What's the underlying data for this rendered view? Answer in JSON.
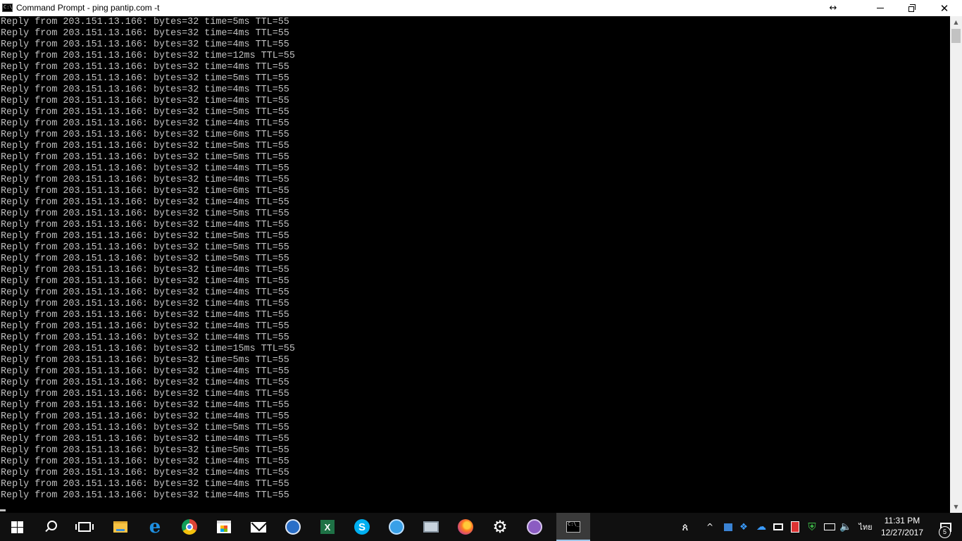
{
  "window": {
    "title": "Command Prompt - ping  pantip.com -t",
    "icon_text": "C:\\",
    "controls": {
      "resize_glyph": "↔",
      "close_glyph": "✕"
    }
  },
  "console": {
    "lines": [
      "Reply from 203.151.13.166: bytes=32 time=5ms TTL=55",
      "Reply from 203.151.13.166: bytes=32 time=4ms TTL=55",
      "Reply from 203.151.13.166: bytes=32 time=4ms TTL=55",
      "Reply from 203.151.13.166: bytes=32 time=12ms TTL=55",
      "Reply from 203.151.13.166: bytes=32 time=4ms TTL=55",
      "Reply from 203.151.13.166: bytes=32 time=5ms TTL=55",
      "Reply from 203.151.13.166: bytes=32 time=4ms TTL=55",
      "Reply from 203.151.13.166: bytes=32 time=4ms TTL=55",
      "Reply from 203.151.13.166: bytes=32 time=5ms TTL=55",
      "Reply from 203.151.13.166: bytes=32 time=4ms TTL=55",
      "Reply from 203.151.13.166: bytes=32 time=6ms TTL=55",
      "Reply from 203.151.13.166: bytes=32 time=5ms TTL=55",
      "Reply from 203.151.13.166: bytes=32 time=5ms TTL=55",
      "Reply from 203.151.13.166: bytes=32 time=4ms TTL=55",
      "Reply from 203.151.13.166: bytes=32 time=4ms TTL=55",
      "Reply from 203.151.13.166: bytes=32 time=6ms TTL=55",
      "Reply from 203.151.13.166: bytes=32 time=4ms TTL=55",
      "Reply from 203.151.13.166: bytes=32 time=5ms TTL=55",
      "Reply from 203.151.13.166: bytes=32 time=4ms TTL=55",
      "Reply from 203.151.13.166: bytes=32 time=5ms TTL=55",
      "Reply from 203.151.13.166: bytes=32 time=5ms TTL=55",
      "Reply from 203.151.13.166: bytes=32 time=5ms TTL=55",
      "Reply from 203.151.13.166: bytes=32 time=4ms TTL=55",
      "Reply from 203.151.13.166: bytes=32 time=4ms TTL=55",
      "Reply from 203.151.13.166: bytes=32 time=4ms TTL=55",
      "Reply from 203.151.13.166: bytes=32 time=4ms TTL=55",
      "Reply from 203.151.13.166: bytes=32 time=4ms TTL=55",
      "Reply from 203.151.13.166: bytes=32 time=4ms TTL=55",
      "Reply from 203.151.13.166: bytes=32 time=4ms TTL=55",
      "Reply from 203.151.13.166: bytes=32 time=15ms TTL=55",
      "Reply from 203.151.13.166: bytes=32 time=5ms TTL=55",
      "Reply from 203.151.13.166: bytes=32 time=4ms TTL=55",
      "Reply from 203.151.13.166: bytes=32 time=4ms TTL=55",
      "Reply from 203.151.13.166: bytes=32 time=4ms TTL=55",
      "Reply from 203.151.13.166: bytes=32 time=4ms TTL=55",
      "Reply from 203.151.13.166: bytes=32 time=4ms TTL=55",
      "Reply from 203.151.13.166: bytes=32 time=5ms TTL=55",
      "Reply from 203.151.13.166: bytes=32 time=4ms TTL=55",
      "Reply from 203.151.13.166: bytes=32 time=5ms TTL=55",
      "Reply from 203.151.13.166: bytes=32 time=4ms TTL=55",
      "Reply from 203.151.13.166: bytes=32 time=4ms TTL=55",
      "Reply from 203.151.13.166: bytes=32 time=4ms TTL=55",
      "Reply from 203.151.13.166: bytes=32 time=4ms TTL=55"
    ],
    "text_color": "#c0c0c0",
    "background": "#000000"
  },
  "scrollbar": {
    "up_glyph": "▲",
    "down_glyph": "▼"
  },
  "taskbar": {
    "apps": [
      {
        "name": "start",
        "icon": "windows-icon"
      },
      {
        "name": "search",
        "icon": "search-icon"
      },
      {
        "name": "task-view",
        "icon": "task-view-icon"
      },
      {
        "name": "file-explorer",
        "icon": "folder-icon"
      },
      {
        "name": "edge",
        "icon": "edge-icon",
        "glyph": "e"
      },
      {
        "name": "chrome",
        "icon": "chrome-icon"
      },
      {
        "name": "store",
        "icon": "store-icon"
      },
      {
        "name": "mail",
        "icon": "mail-icon"
      },
      {
        "name": "mouse-app",
        "icon": "mouse-icon"
      },
      {
        "name": "excel",
        "icon": "excel-icon",
        "glyph": "X"
      },
      {
        "name": "skype",
        "icon": "skype-icon",
        "glyph": "S"
      },
      {
        "name": "lync",
        "icon": "lync-icon"
      },
      {
        "name": "remote-desktop",
        "icon": "screen-icon"
      },
      {
        "name": "firefox",
        "icon": "firefox-icon"
      },
      {
        "name": "settings",
        "icon": "gear-icon",
        "glyph": "⚙"
      },
      {
        "name": "bittorrent",
        "icon": "torrent-icon"
      },
      {
        "name": "command-prompt",
        "icon": "cmd-icon",
        "glyph": "C:\\_",
        "active": true
      }
    ],
    "tray": {
      "people_glyph": "ጰ",
      "overflow_glyph": "^",
      "dropbox_glyph": "❖",
      "onedrive_glyph": "☁",
      "shield_glyph": "⛨",
      "volume_glyph": "🔈",
      "language": "ไทย"
    },
    "clock": {
      "time": "11:31 PM",
      "date": "12/27/2017"
    },
    "notifications": {
      "count": "5"
    }
  }
}
